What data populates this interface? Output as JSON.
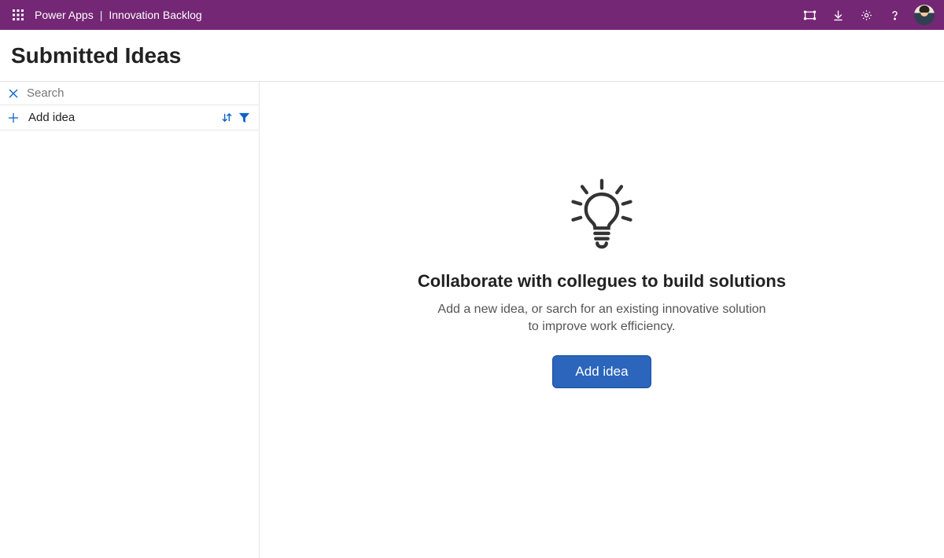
{
  "header": {
    "brand": "Power Apps",
    "app_name": "Innovation Backlog"
  },
  "page": {
    "title": "Submitted Ideas"
  },
  "sidebar": {
    "search_placeholder": "Search",
    "add_idea_label": "Add idea"
  },
  "empty_state": {
    "heading": "Collaborate with collegues to build solutions",
    "body": "Add a new idea, or sarch for an existing innovative solution to improve work efficiency.",
    "cta": "Add idea"
  }
}
